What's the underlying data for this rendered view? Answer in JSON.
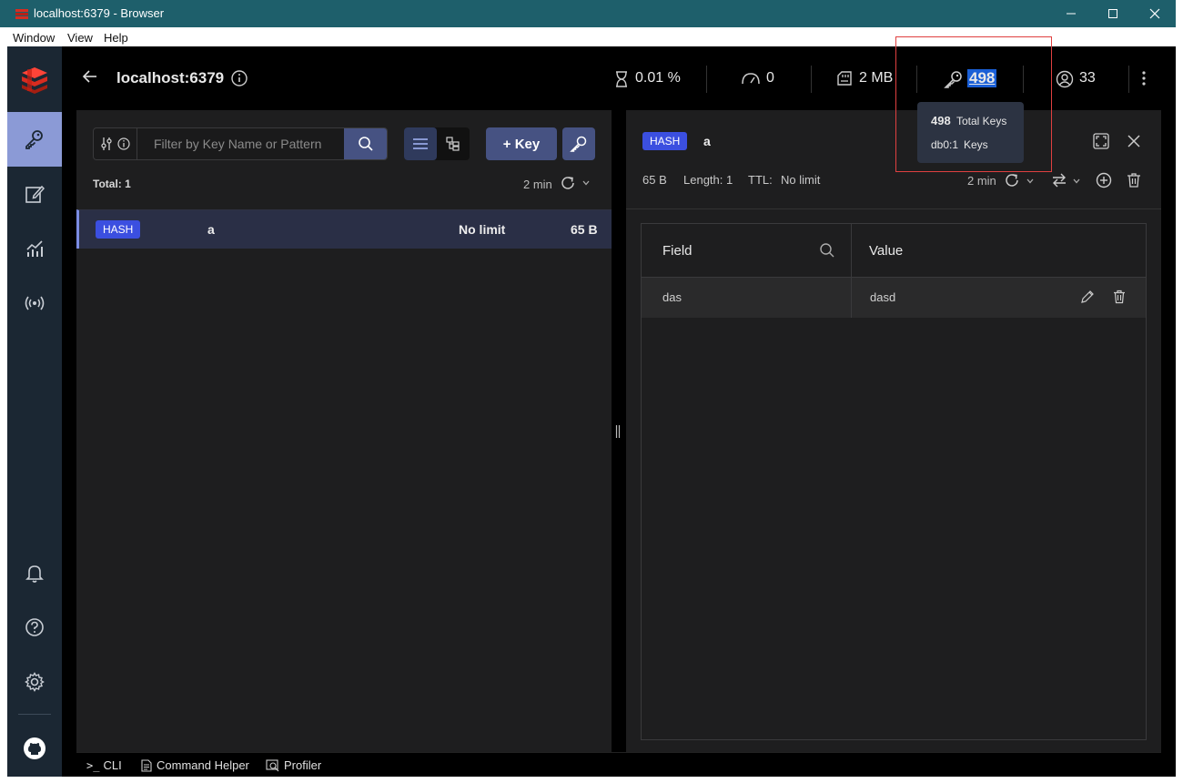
{
  "window": {
    "title": "localhost:6379 - Browser",
    "minimize": "─",
    "maximize": "☐",
    "close": "✕"
  },
  "menu": [
    "Window",
    "View",
    "Help"
  ],
  "header": {
    "db_name": "localhost:6379",
    "cpu": "0.01 %",
    "ops": "0",
    "memory": "2 MB",
    "keys": "498",
    "clients": "33"
  },
  "tooltip": {
    "total_keys_value": "498",
    "total_keys_label": "Total Keys",
    "db_value": "db0:1",
    "db_label": "Keys"
  },
  "browser": {
    "filter_placeholder": "Filter by Key Name or Pattern",
    "add_key_label": "+ Key",
    "total_label": "Total: 1",
    "refresh_time": "2 min",
    "keys": [
      {
        "type": "HASH",
        "name": "a",
        "ttl": "No limit",
        "size": "65 B"
      }
    ]
  },
  "details": {
    "type": "HASH",
    "key_name": "a",
    "size": "65 B",
    "length": "Length: 1",
    "ttl_label": "TTL:",
    "ttl_value": "No limit",
    "refresh_time": "2 min",
    "columns": {
      "field": "Field",
      "value": "Value"
    },
    "rows": [
      {
        "field": "das",
        "value": "dasd"
      }
    ]
  },
  "bottom_bar": {
    "cli": "CLI",
    "command_helper": "Command Helper",
    "profiler": "Profiler"
  },
  "colors": {
    "sidebar_bg": "#1b2733",
    "sidebar_active": "#8b9ad6",
    "panel_bg": "#1e1e1f",
    "accent_button": "#465282",
    "hash_badge": "#3b4fe0",
    "highlight_border": "#e04040",
    "titlebar": "#1e5f6b"
  }
}
